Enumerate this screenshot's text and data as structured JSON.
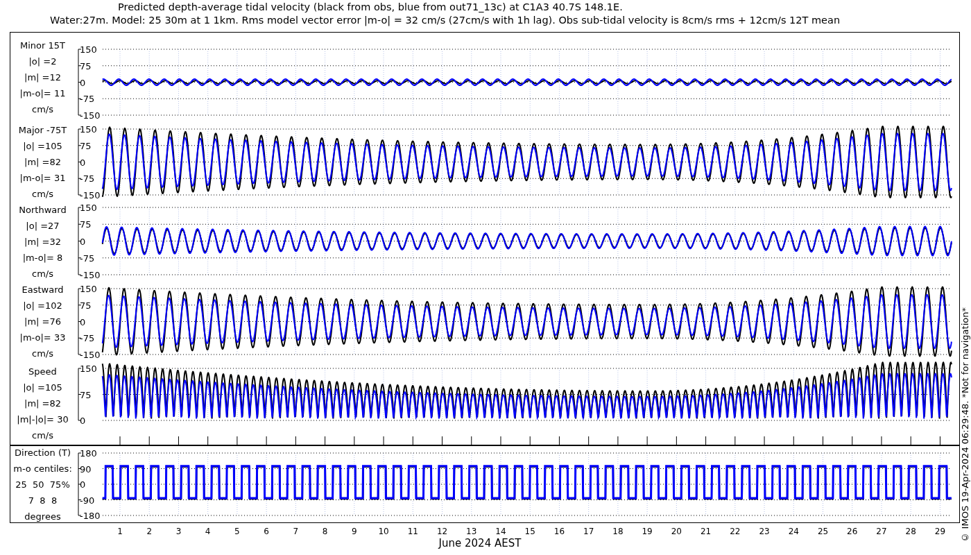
{
  "title_lines": [
    "Predicted depth-average tidal velocity (black from obs, blue from out71_13c) at C1A3 40.7S 148.1E.",
    "Water:27m. Model: 25 30m at 1 1km. Rms model vector error |m-o| = 32 cm/s (27cm/s with 1h lag). Obs sub-tidal velocity is 8cm/s rms + 12cm/s 12T mean"
  ],
  "panels": [
    {
      "kind": "minor",
      "label_lines": [
        "Minor 15T",
        "|o| =2",
        "|m| =12",
        "|m-o|= 11",
        "cm/s"
      ],
      "yticks": [
        "150",
        "75",
        "0",
        "-75",
        "-150"
      ]
    },
    {
      "kind": "major",
      "label_lines": [
        "Major -75T",
        "|o| =105",
        "|m| =82",
        "|m-o|= 31",
        "cm/s"
      ],
      "yticks": [
        "150",
        "75",
        "0",
        "-75",
        "-150"
      ]
    },
    {
      "kind": "northward",
      "label_lines": [
        "Northward",
        "|o| =27",
        "|m| =32",
        "|m-o|= 8",
        "cm/s"
      ],
      "yticks": [
        "150",
        "75",
        "0",
        "-75",
        "-150"
      ]
    },
    {
      "kind": "eastward",
      "label_lines": [
        "Eastward",
        "|o| =102",
        "|m| =76",
        "|m-o|= 33",
        "cm/s"
      ],
      "yticks": [
        "150",
        "75",
        "0",
        "-75",
        "-150"
      ]
    },
    {
      "kind": "speed",
      "label_lines": [
        "Speed",
        "|o| =105",
        "|m| =82",
        "|m|-|o|= 30",
        "cm/s"
      ],
      "yticks": [
        "150",
        "75",
        "0"
      ]
    },
    {
      "kind": "direction",
      "label_lines": [
        "Direction (T)",
        "m-o centiles:",
        "25  50  75%",
        "7  8  8",
        "degrees"
      ],
      "yticks": [
        "180",
        "90",
        "0",
        "-90",
        "-180"
      ]
    }
  ],
  "xticks": [
    "1",
    "2",
    "3",
    "4",
    "5",
    "6",
    "7",
    "8",
    "9",
    "10",
    "11",
    "12",
    "13",
    "14",
    "15",
    "16",
    "17",
    "18",
    "19",
    "20",
    "21",
    "22",
    "23",
    "24",
    "25",
    "26",
    "27",
    "28",
    "29"
  ],
  "xlabel": "June 2024 AEST",
  "credit": "© IMOS 19-Apr-2024 06:29:48. *Not for navigation*"
}
